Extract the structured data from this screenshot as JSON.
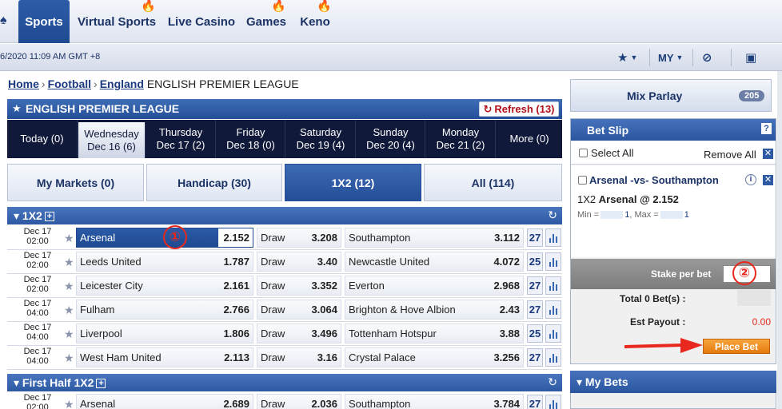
{
  "nav": {
    "items": [
      {
        "label": "Sports",
        "active": true
      },
      {
        "label": "Virtual Sports",
        "flame": true
      },
      {
        "label": "Live Casino"
      },
      {
        "label": "Games",
        "flame": true
      },
      {
        "label": "Keno",
        "flame": true
      }
    ]
  },
  "status": {
    "time": "6/2020 11:09 AM GMT +8",
    "my_label": "MY"
  },
  "breadcrumb": {
    "home": "Home",
    "football": "Football",
    "country": "England",
    "league": "ENGLISH PREMIER LEAGUE",
    "sep": "›"
  },
  "league_header": {
    "title": "ENGLISH PREMIER LEAGUE",
    "refresh_label": "Refresh (13)"
  },
  "date_tabs": [
    {
      "line1": "Today (0)",
      "line2": ""
    },
    {
      "line1": "Wednesday",
      "line2": "Dec 16 (6)",
      "active": true
    },
    {
      "line1": "Thursday",
      "line2": "Dec 17 (2)"
    },
    {
      "line1": "Friday",
      "line2": "Dec 18 (0)"
    },
    {
      "line1": "Saturday",
      "line2": "Dec 19 (4)"
    },
    {
      "line1": "Sunday",
      "line2": "Dec 20 (4)"
    },
    {
      "line1": "Monday",
      "line2": "Dec 21 (2)"
    },
    {
      "line1": "More (0)",
      "line2": ""
    }
  ],
  "market_tabs": [
    {
      "label": "My Markets (0)"
    },
    {
      "label": "Handicap (30)"
    },
    {
      "label": "1X2 (12)",
      "active": true
    },
    {
      "label": "All (114)"
    }
  ],
  "sections": {
    "s1": "1X2",
    "s2": "First Half 1X2",
    "plus": "+"
  },
  "matches": [
    {
      "date": "Dec 17",
      "time": "02:00",
      "home": "Arsenal",
      "home_odds": "2.152",
      "draw": "Draw",
      "draw_odds": "3.208",
      "away": "Southampton",
      "away_odds": "3.112",
      "count": "27"
    },
    {
      "date": "Dec 17",
      "time": "02:00",
      "home": "Leeds United",
      "home_odds": "1.787",
      "draw": "Draw",
      "draw_odds": "3.40",
      "away": "Newcastle United",
      "away_odds": "4.072",
      "count": "25"
    },
    {
      "date": "Dec 17",
      "time": "02:00",
      "home": "Leicester City",
      "home_odds": "2.161",
      "draw": "Draw",
      "draw_odds": "3.352",
      "away": "Everton",
      "away_odds": "2.968",
      "count": "27"
    },
    {
      "date": "Dec 17",
      "time": "04:00",
      "home": "Fulham",
      "home_odds": "2.766",
      "draw": "Draw",
      "draw_odds": "3.064",
      "away": "Brighton & Hove Albion",
      "away_odds": "2.43",
      "count": "27"
    },
    {
      "date": "Dec 17",
      "time": "04:00",
      "home": "Liverpool",
      "home_odds": "1.806",
      "draw": "Draw",
      "draw_odds": "3.496",
      "away": "Tottenham Hotspur",
      "away_odds": "3.88",
      "count": "25"
    },
    {
      "date": "Dec 17",
      "time": "04:00",
      "home": "West Ham United",
      "home_odds": "2.113",
      "draw": "Draw",
      "draw_odds": "3.16",
      "away": "Crystal Palace",
      "away_odds": "3.256",
      "count": "27"
    }
  ],
  "first_half": [
    {
      "date": "Dec 17",
      "time": "02:00",
      "home": "Arsenal",
      "home_odds": "2.689",
      "draw": "Draw",
      "draw_odds": "2.036",
      "away": "Southampton",
      "away_odds": "3.784",
      "count": "27"
    }
  ],
  "annotations": {
    "one": "①",
    "two": "②"
  },
  "mix_parlay": {
    "label": "Mix Parlay",
    "count": "205"
  },
  "bet_slip": {
    "title": "Bet Slip",
    "help": "?",
    "select_all": "Select All",
    "remove_all": "Remove All",
    "match": "Arsenal -vs- Southampton",
    "pick_market": "1X2",
    "pick_team": "Arsenal",
    "pick_odds": "@ 2.152",
    "min_label": "Min =",
    "min_val": "1",
    "max_label": ", Max =",
    "max_val": "1",
    "stake_label": "Stake per bet",
    "total_label": "Total 0 Bet(s) :",
    "payout_label": "Est Payout :",
    "payout_value": "0.00",
    "place_bet": "Place Bet"
  },
  "my_bets": {
    "label": "My Bets"
  },
  "colors": {
    "accent": "#2b569f",
    "payout": "#e8281e",
    "place_bet": "#ef8c1f"
  }
}
